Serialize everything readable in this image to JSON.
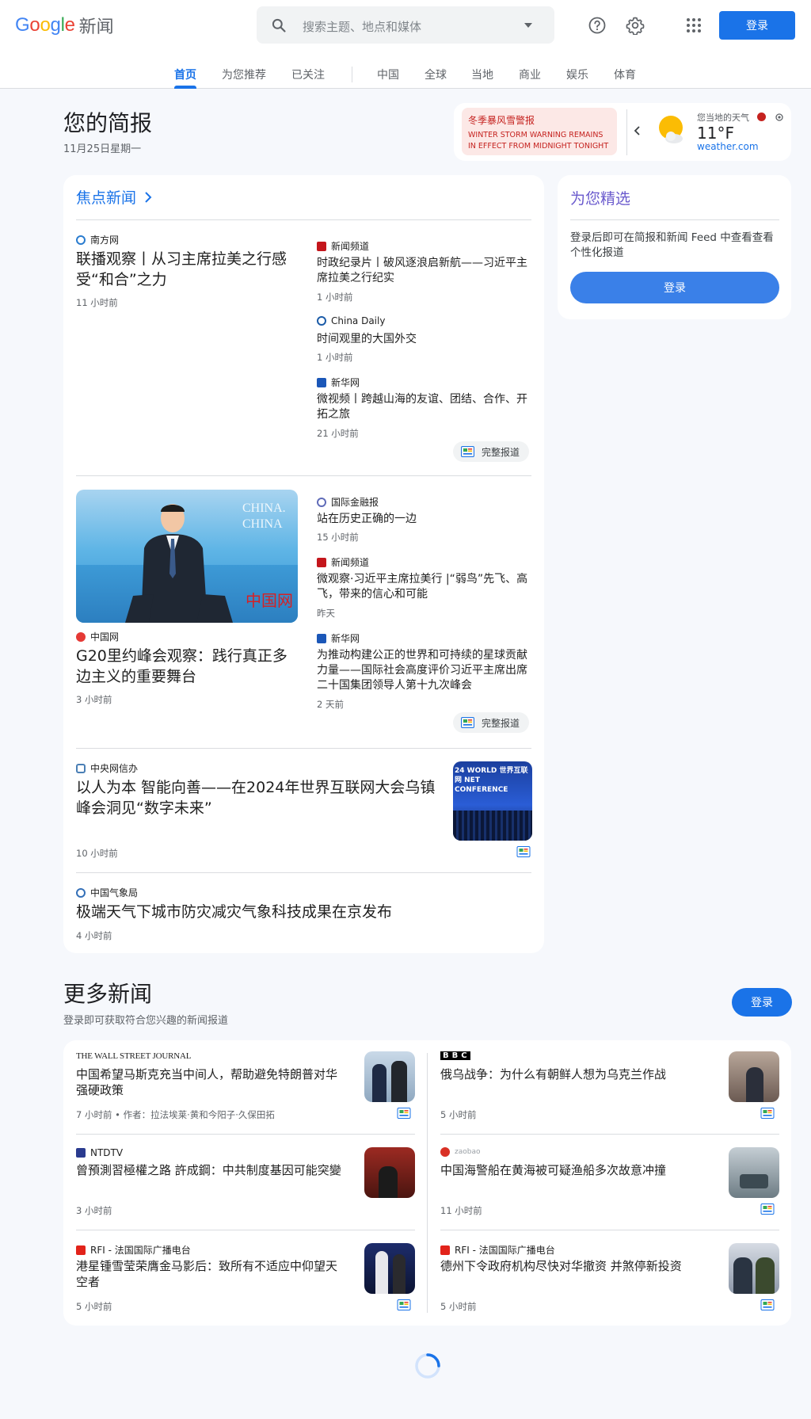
{
  "header": {
    "logo_text": "Google",
    "logo_suffix": "新闻",
    "search_placeholder": "搜索主题、地点和媒体",
    "signin_label": "登录"
  },
  "tabs": [
    {
      "label": "首页",
      "active": true
    },
    {
      "label": "为您推荐"
    },
    {
      "label": "已关注"
    },
    {
      "label": "中国"
    },
    {
      "label": "全球"
    },
    {
      "label": "当地"
    },
    {
      "label": "商业"
    },
    {
      "label": "娱乐"
    },
    {
      "label": "体育"
    }
  ],
  "briefing": {
    "title": "您的简报",
    "date": "11月25日星期一"
  },
  "weather": {
    "alert_title": "冬季暴风雪警报",
    "alert_text": "WINTER STORM WARNING REMAINS IN EFFECT FROM MIDNIGHT TONIGHT T...",
    "label": "您当地的天气",
    "temperature": "11°F",
    "source": "weather.com"
  },
  "top_stories": {
    "heading": "焦点新闻",
    "full_coverage_label": "完整报道",
    "cluster1": {
      "main": {
        "source": "南方网",
        "title": "联播观察丨从习主席拉美之行感受“和合”之力",
        "time": "11 小时前"
      },
      "side": [
        {
          "source": "新闻频道",
          "title": "时政纪录片丨破风逐浪启新航——习近平主席拉美之行纪实",
          "time": "1 小时前"
        },
        {
          "source": "China Daily",
          "title": "时间观里的大国外交",
          "time": "1 小时前"
        },
        {
          "source": "新华网",
          "title": "微视频丨跨越山海的友谊、团结、合作、开拓之旅",
          "time": "21 小时前"
        }
      ]
    },
    "cluster2": {
      "main": {
        "source": "中国网",
        "title": "G20里约峰会观察：践行真正多边主义的重要舞台",
        "time": "3 小时前",
        "image_caption": "CHINA. CHINA",
        "image_logo": "中国网"
      },
      "side": [
        {
          "source": "国际金融报",
          "title": "站在历史正确的一边",
          "time": "15 小时前"
        },
        {
          "source": "新闻频道",
          "title": "微观察·习近平主席拉美行 |“弱鸟”先飞、高飞，带来的信心和可能",
          "time": "昨天"
        },
        {
          "source": "新华网",
          "title": "为推动构建公正的世界和可持续的星球贡献力量——国际社会高度评价习近平主席出席二十国集团领导人第十九次峰会",
          "time": "2 天前"
        }
      ]
    },
    "story3": {
      "source": "中央网信办",
      "title": "以人为本 智能向善——在2024年世界互联网大会乌镇峰会洞见“数字未来”",
      "time": "10 小时前",
      "image_caption": "24 WORLD 世界互联网 NET CONFERENCE"
    },
    "story4": {
      "source": "中国气象局",
      "title": "极端天气下城市防灾减灾气象科技成果在京发布",
      "time": "4 小时前"
    }
  },
  "picks": {
    "heading": "为您精选",
    "text": "登录后即可在简报和新闻 Feed 中查看查看个性化报道",
    "button": "登录"
  },
  "more_news": {
    "title": "更多新闻",
    "subtitle": "登录即可获取符合您兴趣的新闻报道",
    "button": "登录",
    "items": [
      {
        "source": "THE WALL STREET JOURNAL",
        "title": "中国希望马斯克充当中间人，帮助避免特朗普对华强硬政策",
        "time": "7 小时前 • 作者：拉法埃莱·黄和今阳子·久保田拓"
      },
      {
        "source": "BBC",
        "title": "俄乌战争：为什么有朝鲜人想为乌克兰作战",
        "time": "5 小时前"
      },
      {
        "source": "NTDTV",
        "title": "曾預測習極權之路 許成鋼：中共制度基因可能突變",
        "time": "3 小时前"
      },
      {
        "source": "zaobao",
        "title": "中国海警船在黄海被可疑渔船多次故意冲撞",
        "time": "11 小时前"
      },
      {
        "source": "RFI - 法国国际广播电台",
        "title": "港星锺雪莹荣膺金马影后：致所有不适应中仰望天空者",
        "time": "5 小时前"
      },
      {
        "source": "RFI - 法国国际广播电台",
        "title": "德州下令政府机构尽快对华撤资 并煞停新投资",
        "time": "5 小时前"
      }
    ]
  }
}
